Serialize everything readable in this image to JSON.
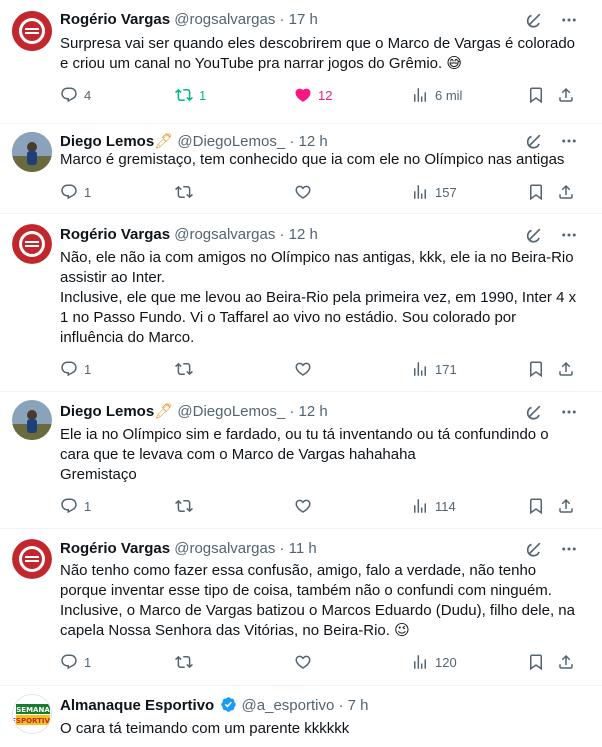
{
  "tweets": [
    {
      "name": "Rogério Vargas",
      "handle": "@rogsalvargas",
      "dot": "·",
      "time": "17 h",
      "text": "Surpresa vai ser quando eles descobrirem que o Marco de Vargas é colorado e criou um canal no YouTube pra narrar jogos do Grêmio. 😅",
      "replies": "4",
      "retweets": "1",
      "likes": "12",
      "views": "6 mil"
    },
    {
      "name": "Diego Lemos",
      "handle": "@DiegoLemos_",
      "dot": "·",
      "time": "12 h",
      "text": "Marco é gremistaço, tem conhecido que ia com ele no Olímpico nas antigas",
      "replies": "1",
      "retweets": "",
      "likes": "",
      "views": "157"
    },
    {
      "name": "Rogério Vargas",
      "handle": "@rogsalvargas",
      "dot": "·",
      "time": "12 h",
      "text": "Não, ele não ia com amigos no Olímpico nas antigas, kkk, ele ia no Beira-Rio assistir ao Inter.\nInclusive, ele que me levou ao Beira-Rio pela primeira vez, em 1990, Inter 4 x 1 no Passo Fundo. Vi o Taffarel ao vivo no estádio. Sou colorado por influência do Marco.",
      "replies": "1",
      "retweets": "",
      "likes": "",
      "views": "171"
    },
    {
      "name": "Diego Lemos",
      "handle": "@DiegoLemos_",
      "dot": "·",
      "time": "12 h",
      "text": "Ele ia no Olímpico sim e fardado, ou tu tá inventando ou tá confundindo o cara que te levava com o Marco de Vargas hahahaha\nGremistaço",
      "replies": "1",
      "retweets": "",
      "likes": "",
      "views": "114"
    },
    {
      "name": "Rogério Vargas",
      "handle": "@rogsalvargas",
      "dot": "·",
      "time": "11 h",
      "text": "Não tenho como fazer essa confusão, amigo, falo a verdade, não tenho porque inventar esse tipo de coisa, também não o confundi com ninguém.\nInclusive, o Marco de Vargas batizou o Marcos Eduardo (Dudu), filho dele, na capela Nossa Senhora das Vitórias, no Beira-Rio. 😉",
      "replies": "1",
      "retweets": "",
      "likes": "",
      "views": "120"
    },
    {
      "name": "Almanaque Esportivo",
      "handle": "@a_esportivo",
      "dot": "·",
      "time": "7 h",
      "text": "O cara tá teimando com um parente kkkkkk",
      "avatar_text": "SEMANA ESPORTIVA"
    }
  ],
  "colors": {
    "text": "#0f1419",
    "muted": "#536471",
    "retweet_active": "#00ba7c",
    "like_active": "#f91880",
    "verified": "#1d9bf0"
  }
}
